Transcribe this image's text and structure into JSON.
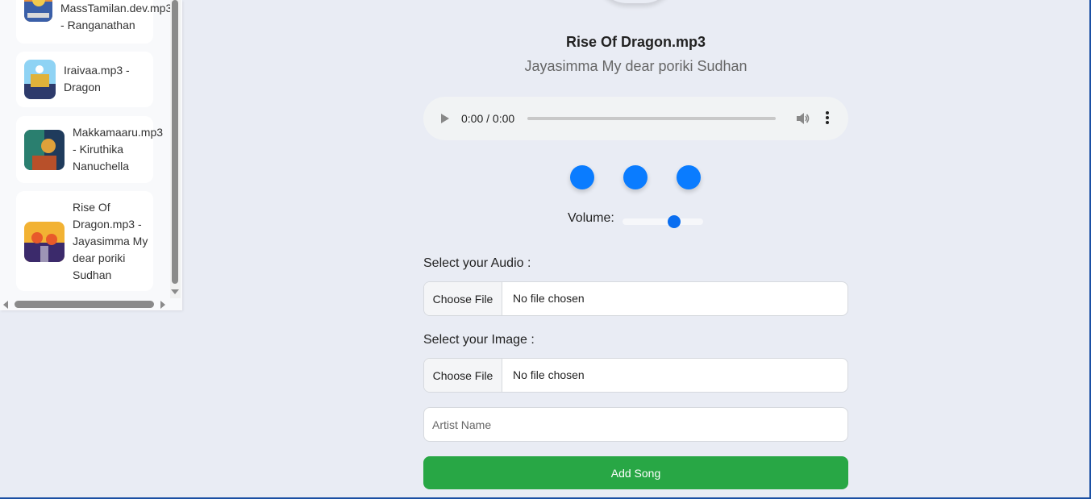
{
  "sidebar": {
    "items": [
      {
        "title": "MassTamilan.dev.mp3",
        "artist": "Ranganathan",
        "thumb_colors": [
          "#e8913a",
          "#3a5fa8",
          "#f2c94c"
        ]
      },
      {
        "title": "Iraivaa.mp3",
        "artist": "Dragon",
        "thumb_colors": [
          "#8fd3f4",
          "#e0b23a",
          "#2d3a6b"
        ]
      },
      {
        "title": "Makkamaaru.mp3",
        "artist": "Kiruthika Nanuchella",
        "thumb_colors": [
          "#1f3b5c",
          "#e0a13a",
          "#2a7f6f"
        ]
      },
      {
        "title": "Rise Of Dragon.mp3",
        "artist": "Jayasimma My dear poriki Sudhan",
        "thumb_colors": [
          "#e85a2a",
          "#f2b233",
          "#3b2a6b"
        ]
      }
    ]
  },
  "player": {
    "title": "Rise Of Dragon.mp3",
    "artist": "Jayasimma My dear poriki Sudhan",
    "time": "0:00 / 0:00",
    "volume_label": "Volume:",
    "volume_level": 0.67,
    "accent": "#0a7cff"
  },
  "form": {
    "audio_label": "Select your Audio :",
    "image_label": "Select your Image :",
    "choose_file": "Choose File",
    "no_file": "No file chosen",
    "artist_placeholder": "Artist Name",
    "add_button": "Add Song",
    "add_button_color": "#28a745"
  }
}
